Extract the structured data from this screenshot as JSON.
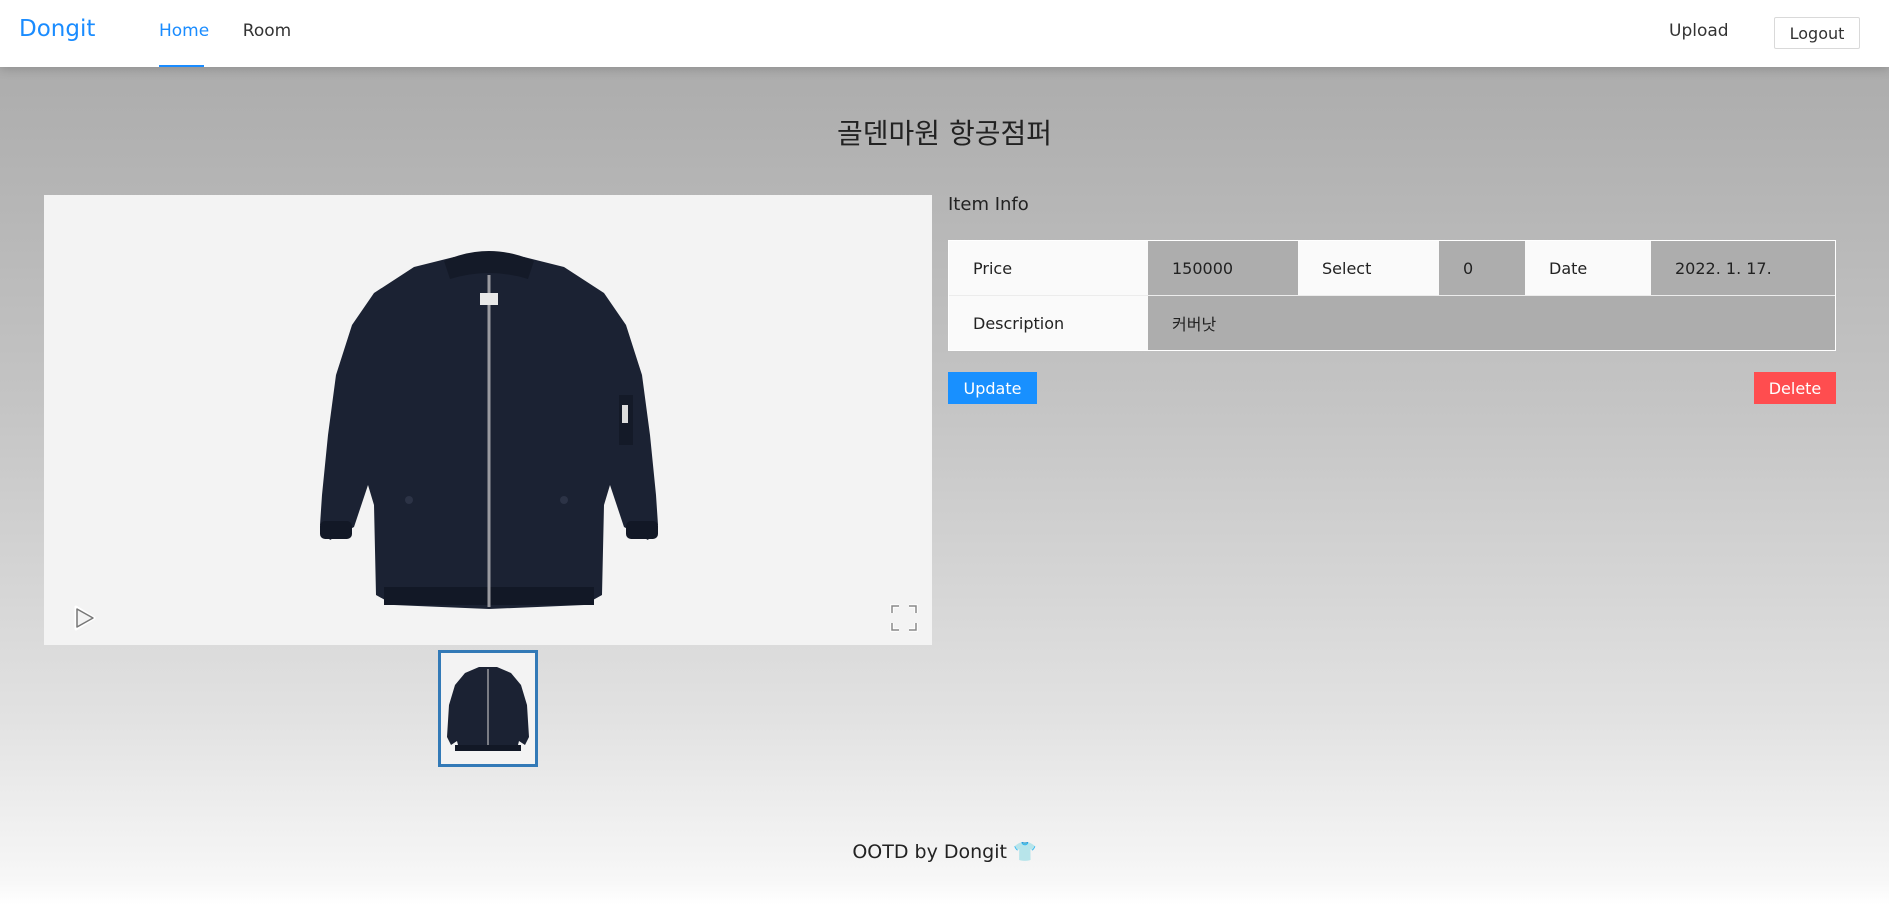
{
  "header": {
    "brand": "Dongit",
    "nav": [
      {
        "label": "Home",
        "active": true
      },
      {
        "label": "Room",
        "active": false
      }
    ],
    "upload_label": "Upload",
    "logout_label": "Logout"
  },
  "item": {
    "title": "골덴마원 항공점퍼",
    "info_heading": "Item Info",
    "fields": {
      "price_label": "Price",
      "price_value": "150000",
      "select_label": "Select",
      "select_value": "0",
      "date_label": "Date",
      "date_value": "2022. 1. 17.",
      "description_label": "Description",
      "description_value": "커버낫"
    },
    "update_label": "Update",
    "delete_label": "Delete"
  },
  "gallery": {
    "icons": [
      "play-icon",
      "fullscreen-icon"
    ]
  },
  "footer": {
    "text": "OOTD by Dongit 👕"
  },
  "colors": {
    "accent": "#1a8cff",
    "update": "#1890ff",
    "delete": "#ff4d4f",
    "thumb_border": "#337ab7"
  }
}
